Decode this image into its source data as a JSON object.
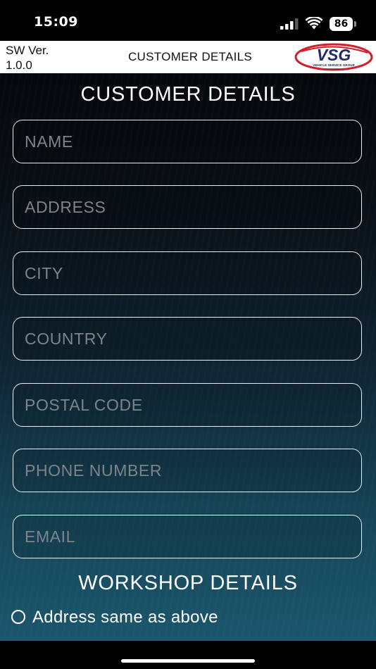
{
  "status_bar": {
    "time": "15:09",
    "battery": "86"
  },
  "header": {
    "sw_version_line1": "SW Ver.",
    "sw_version_line2": "1.0.0",
    "title": "CUSTOMER DETAILS",
    "logo_text": "VSG",
    "logo_subtext": "VEHICLE SERVICE GROUP",
    "logo_tagline": "a company"
  },
  "customer_section": {
    "title": "CUSTOMER DETAILS",
    "fields": [
      {
        "placeholder": "NAME",
        "value": ""
      },
      {
        "placeholder": "ADDRESS",
        "value": ""
      },
      {
        "placeholder": "CITY",
        "value": ""
      },
      {
        "placeholder": "COUNTRY",
        "value": ""
      },
      {
        "placeholder": "POSTAL CODE",
        "value": ""
      },
      {
        "placeholder": "PHONE NUMBER",
        "value": ""
      },
      {
        "placeholder": "EMAIL",
        "value": ""
      }
    ]
  },
  "workshop_section": {
    "title": "WORKSHOP DETAILS",
    "same_address_label": "Address same as above",
    "same_address_checked": false
  },
  "colors": {
    "accent_red": "#d11f2a",
    "logo_navy": "#1d2c6b",
    "field_border": "#e9edf0",
    "placeholder": "#7e8489"
  },
  "icons": [
    "signal-icon",
    "wifi-icon",
    "battery-icon",
    "vsg-logo",
    "radio-icon"
  ]
}
